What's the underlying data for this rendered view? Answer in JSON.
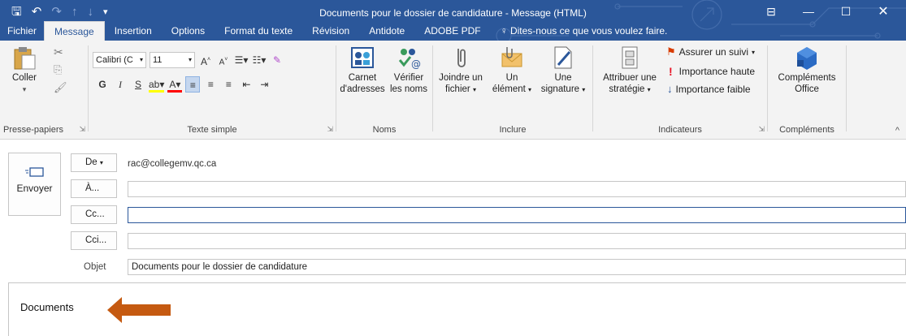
{
  "window": {
    "title": "Documents pour le dossier de candidature - Message (HTML)",
    "qat_icons": [
      "save-icon",
      "undo-icon",
      "redo-icon",
      "arrow-up-icon",
      "arrow-down-icon",
      "customize-qat-icon"
    ],
    "controls": [
      "ribbon-display-icon",
      "minimize-icon",
      "maximize-icon",
      "close-icon"
    ]
  },
  "tabs": [
    "Fichier",
    "Message",
    "Insertion",
    "Options",
    "Format du texte",
    "Révision",
    "Antidote",
    "ADOBE PDF"
  ],
  "active_tab": "Message",
  "tell_me": "Dites-nous ce que vous voulez faire.",
  "ribbon": {
    "clipboard": {
      "paste_label": "Coller",
      "group_label": "Presse-papiers"
    },
    "basic_text": {
      "font_name": "Calibri (C",
      "font_size": "11",
      "bold": "G",
      "italic": "I",
      "underline": "S",
      "group_label": "Texte simple"
    },
    "names": {
      "address_book_line1": "Carnet",
      "address_book_line2": "d'adresses",
      "check_names_line1": "Vérifier",
      "check_names_line2": "les noms",
      "group_label": "Noms"
    },
    "include": {
      "attach_line1": "Joindre un",
      "attach_line2": "fichier",
      "item_line1": "Un",
      "item_line2": "élément",
      "signature_line1": "Une",
      "signature_line2": "signature",
      "group_label": "Inclure"
    },
    "tags": {
      "policy_line1": "Attribuer une",
      "policy_line2": "stratégie",
      "followup": "Assurer un suivi",
      "high_importance": "Importance haute",
      "low_importance": "Importance faible",
      "group_label": "Indicateurs"
    },
    "addins": {
      "office_line1": "Compléments",
      "office_line2": "Office",
      "group_label": "Compléments"
    }
  },
  "compose": {
    "send_label": "Envoyer",
    "from_label": "De",
    "from_value": "rac@collegemv.qc.ca",
    "to_label": "À...",
    "cc_label": "Cc...",
    "bcc_label": "Cci...",
    "subject_label": "Objet",
    "subject_value": "Documents pour le dossier de candidature",
    "body_text": "Documents"
  },
  "colors": {
    "titlebar": "#2b579a",
    "ribbon": "#f3f3f3",
    "arrow": "#c55a11"
  }
}
